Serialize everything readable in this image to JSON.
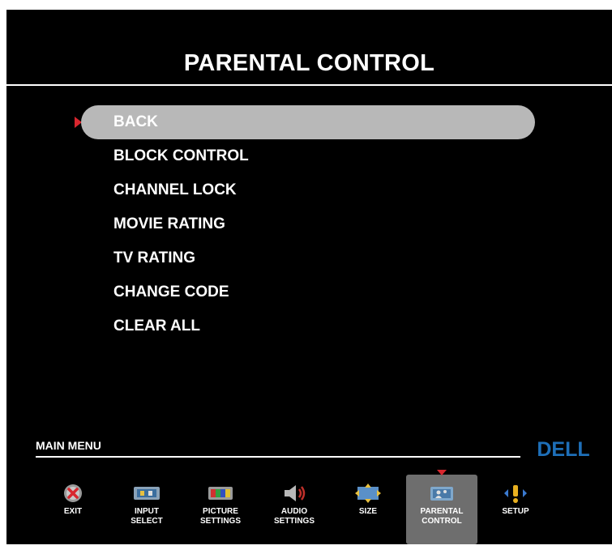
{
  "header": {
    "title": "PARENTAL CONTROL"
  },
  "menu": {
    "selected_index": 0,
    "items": [
      {
        "label": "BACK"
      },
      {
        "label": "BLOCK CONTROL"
      },
      {
        "label": "CHANNEL LOCK"
      },
      {
        "label": "MOVIE RATING"
      },
      {
        "label": "TV RATING"
      },
      {
        "label": "CHANGE CODE"
      },
      {
        "label": "CLEAR ALL"
      }
    ]
  },
  "main_menu": {
    "label": "MAIN MENU",
    "brand": "DELL",
    "items": [
      {
        "label": "EXIT",
        "icon": "exit-icon"
      },
      {
        "label": "INPUT\nSELECT",
        "icon": "input-select-icon"
      },
      {
        "label": "PICTURE\nSETTINGS",
        "icon": "picture-settings-icon"
      },
      {
        "label": "AUDIO\nSETTINGS",
        "icon": "audio-settings-icon"
      },
      {
        "label": "SIZE",
        "icon": "size-icon"
      },
      {
        "label": "PARENTAL\nCONTROL",
        "icon": "parental-control-icon",
        "active": true
      },
      {
        "label": "SETUP",
        "icon": "setup-icon"
      }
    ]
  },
  "colors": {
    "screen_background": "#000000",
    "selection_highlight": "#b8b8b8",
    "active_tab": "#6e6e6e",
    "pointer_red": "#d8262e",
    "dell_blue": "#1e6fb8"
  }
}
